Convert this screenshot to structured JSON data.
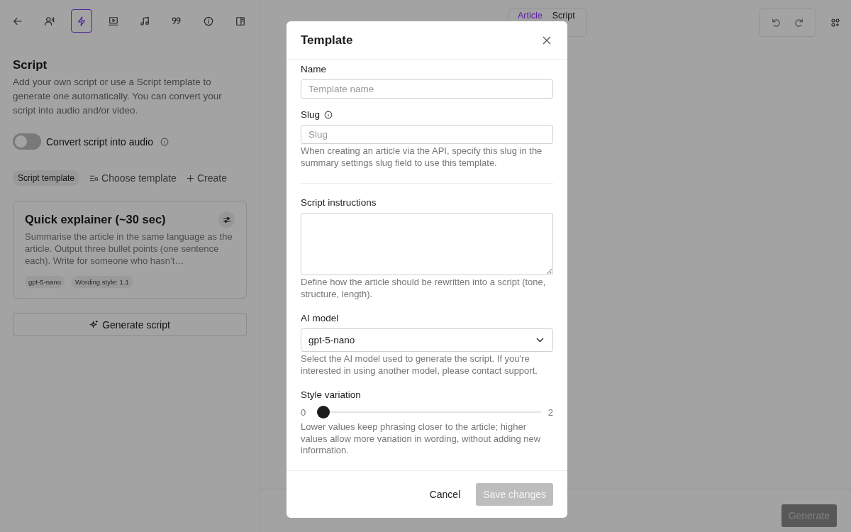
{
  "sidebar_toolbar": [
    {
      "kind": "back",
      "selected": false
    },
    {
      "kind": "voice",
      "selected": false
    },
    {
      "kind": "lightning",
      "selected": true
    },
    {
      "kind": "video",
      "selected": false
    },
    {
      "kind": "music",
      "selected": false
    },
    {
      "kind": "quote",
      "selected": false
    },
    {
      "kind": "info",
      "selected": false
    },
    {
      "kind": "panel",
      "selected": false
    }
  ],
  "script_panel": {
    "title": "Script",
    "description": "Add your own script or use a Script template to generate one automatically. You can convert your script into audio and/or video.",
    "audio_toggle": {
      "label": "Convert script into audio",
      "on": false
    },
    "template_label": "Script template",
    "choose_link": "Choose template",
    "create_link": "Create",
    "template_card": {
      "title": "Quick explainer (~30 sec)",
      "description": "Summarise the article in the same language as the article. Output three bullet points (one sentence each). Write for someone who hasn’t…",
      "tags": [
        "gpt-5-nano",
        "Wording style: 1.1"
      ]
    },
    "generate_script_button": "Generate script"
  },
  "editor_tabs": [
    {
      "label": "Article",
      "selected": true
    },
    {
      "label": "Script",
      "selected": false
    }
  ],
  "generate_button": {
    "label": "Generate",
    "disabled": true
  },
  "modal": {
    "title": "Template",
    "name_field": {
      "label": "Name",
      "placeholder": "Template name"
    },
    "slug_field": {
      "label": "Slug",
      "placeholder": "Slug",
      "help": "When creating an article via the API, specify this slug in the summary settings slug field to use this template."
    },
    "instructions_field": {
      "label": "Script instructions",
      "help": "Define how the article should be rewritten into a script (tone, structure, length)."
    },
    "model_select": {
      "label": "AI model",
      "value": "gpt-5-nano",
      "help": "Select the AI model used to generate the script. If you're interested in using another model, please contact support."
    },
    "style_slider": {
      "label": "Style variation",
      "min_label": "0",
      "max_label": "2",
      "level": 0,
      "help": "Lower values keep phrasing closer to the article; higher values allow more variation in wording, without adding new information."
    },
    "cancel_button": "Cancel",
    "save_button": {
      "label": "Save changes",
      "disabled": true
    }
  }
}
